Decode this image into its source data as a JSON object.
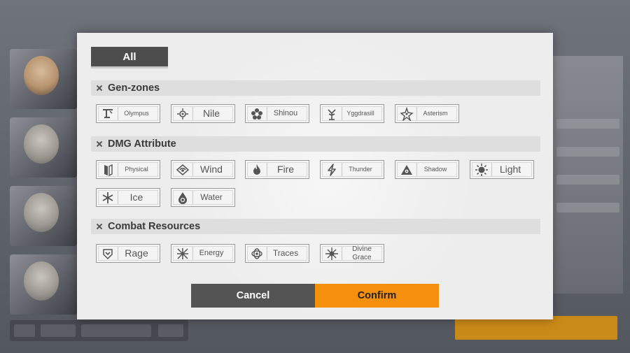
{
  "filter_all_label": "All",
  "sections": {
    "gen_zones": {
      "title": "Gen-zones",
      "items": [
        {
          "label": "Olympus",
          "icon": "olympus-icon"
        },
        {
          "label": "Nile",
          "icon": "nile-icon"
        },
        {
          "label": "Shinou",
          "icon": "shinou-icon"
        },
        {
          "label": "Yggdrasill",
          "icon": "yggdrasill-icon"
        },
        {
          "label": "Asterism",
          "icon": "asterism-icon"
        }
      ]
    },
    "dmg_attribute": {
      "title": "DMG Attribute",
      "items": [
        {
          "label": "Physical",
          "icon": "physical-icon"
        },
        {
          "label": "Wind",
          "icon": "wind-icon"
        },
        {
          "label": "Fire",
          "icon": "fire-icon"
        },
        {
          "label": "Thunder",
          "icon": "thunder-icon"
        },
        {
          "label": "Shadow",
          "icon": "shadow-icon"
        },
        {
          "label": "Light",
          "icon": "light-icon"
        },
        {
          "label": "Ice",
          "icon": "ice-icon"
        },
        {
          "label": "Water",
          "icon": "water-icon"
        }
      ]
    },
    "combat_resources": {
      "title": "Combat Resources",
      "items": [
        {
          "label": "Rage",
          "icon": "rage-icon"
        },
        {
          "label": "Energy",
          "icon": "energy-icon"
        },
        {
          "label": "Traces",
          "icon": "traces-icon"
        },
        {
          "label": "Divine Grace",
          "icon": "divine-grace-icon"
        }
      ]
    }
  },
  "actions": {
    "cancel_label": "Cancel",
    "confirm_label": "Confirm"
  },
  "colors": {
    "confirm_accent": "#f4900c",
    "cancel_bg": "#545454",
    "dialog_bg": "#ededed"
  }
}
